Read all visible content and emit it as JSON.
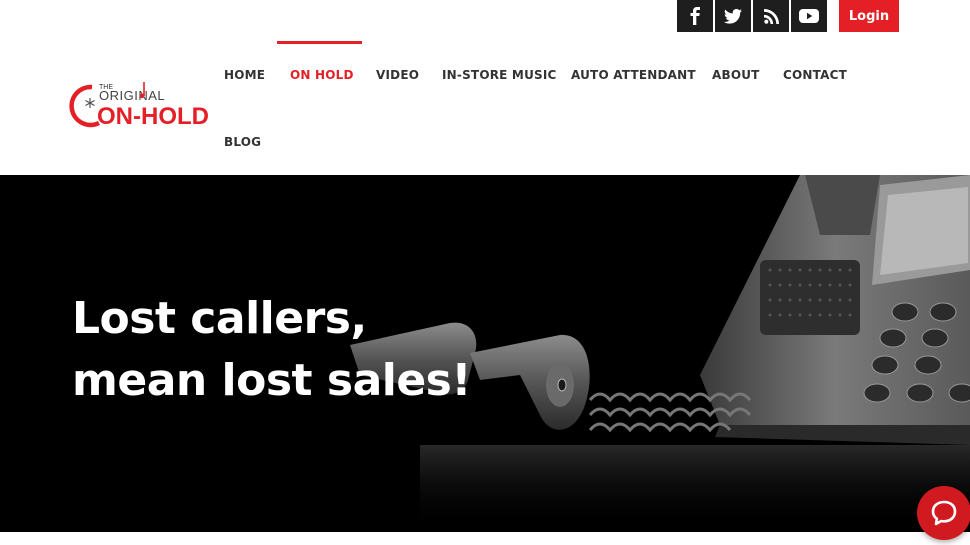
{
  "social": {
    "facebook_icon": "facebook-icon",
    "twitter_icon": "twitter-icon",
    "rss_icon": "rss-icon",
    "youtube_icon": "youtube-icon"
  },
  "login": {
    "label": "Login"
  },
  "logo": {
    "line1": "THE",
    "line2": "ORIGINAL",
    "line3": "ON-HOLD"
  },
  "nav": {
    "items": [
      {
        "label": "HOME"
      },
      {
        "label": "ON HOLD"
      },
      {
        "label": "VIDEO"
      },
      {
        "label": "IN-STORE MUSIC"
      },
      {
        "label": "AUTO ATTENDANT"
      },
      {
        "label": "ABOUT"
      },
      {
        "label": "CONTACT"
      },
      {
        "label": "BLOG"
      }
    ],
    "active": "ON HOLD"
  },
  "hero": {
    "headline_line1": "Lost callers,",
    "headline_line2": "mean lost sales!"
  },
  "chat": {
    "icon": "chat-bubble-icon"
  },
  "colors": {
    "accent": "#e41f26",
    "dark": "#1e1e1e",
    "nav_text": "#333333"
  }
}
